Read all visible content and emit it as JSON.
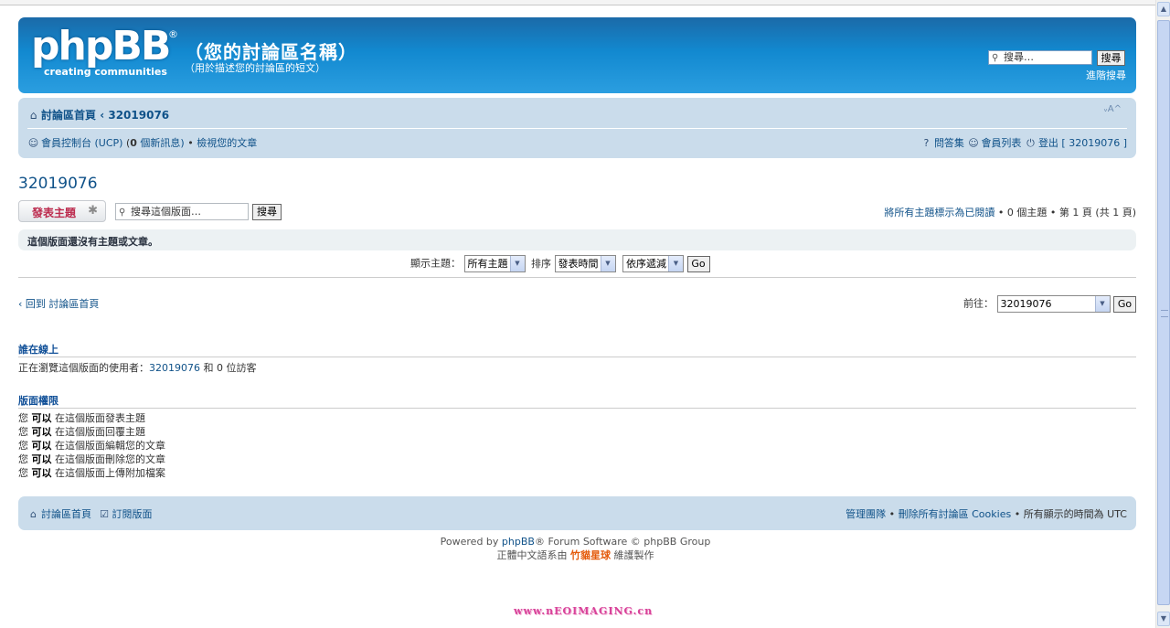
{
  "header": {
    "logo_word": "phpBB",
    "logo_reg": "®",
    "logo_tagline": "creating   communities",
    "site_title": "（您的討論區名稱）",
    "site_desc": "（用於描述您的討論區的短文）",
    "search_placeholder": "搜尋…",
    "search_button": "搜尋",
    "advanced_search": "進階搜尋"
  },
  "navbar": {
    "home": "討論區首頁",
    "crumb_sep": "‹",
    "crumb_current": "32019076",
    "font_size_toggle": "ᵥA^",
    "ucp": "會員控制台 (UCP)",
    "pm_open": "(",
    "pm_count": "0",
    "pm_text": " 個新訊息)",
    "bullet": "•",
    "view_posts": "檢視您的文章",
    "faq": "問答集",
    "memberlist": "會員列表",
    "logout": "登出 [ 32019076 ]"
  },
  "forum": {
    "title": "32019076",
    "post_button": "發表主題",
    "search_placeholder": "搜尋這個版面…",
    "search_button": "搜尋",
    "mark_read": "將所有主題標示為已閱讀",
    "topic_count": "0 個主題",
    "page_info": "第 1 頁 (共 1 頁)",
    "no_topics": "這個版面還沒有主題或文章。"
  },
  "sort": {
    "display_label": "顯示主題：",
    "display_value": "所有主題",
    "sort_label": "排序",
    "sort_value": "發表時間",
    "order_value": "依序遞減",
    "go": "Go"
  },
  "jump": {
    "return_link": "回到 討論區首頁",
    "jump_label": "前往：",
    "jump_value": "32019076",
    "go": "Go"
  },
  "online": {
    "title": "誰在線上",
    "text_prefix": "正在瀏覽這個版面的使用者：",
    "user": "32019076",
    "text_suffix": " 和 0 位訪客"
  },
  "permissions": {
    "title": "版面權限",
    "items": [
      {
        "you": "您",
        "can": "可以",
        "text": "在這個版面發表主題"
      },
      {
        "you": "您",
        "can": "可以",
        "text": "在這個版面回覆主題"
      },
      {
        "you": "您",
        "can": "可以",
        "text": "在這個版面編輯您的文章"
      },
      {
        "you": "您",
        "can": "可以",
        "text": "在這個版面刪除您的文章"
      },
      {
        "you": "您",
        "can": "可以",
        "text": "在這個版面上傳附加檔案"
      }
    ]
  },
  "footer": {
    "home": "討論區首頁",
    "subscribe": "訂閱版面",
    "team": "管理團隊",
    "delete_cookies": "刪除所有討論區 Cookies",
    "timezone": "所有顯示的時間為 UTC"
  },
  "copyright": {
    "powered_prefix": "Powered by ",
    "powered_brand": "phpBB",
    "powered_suffix": "® Forum Software © phpBB Group",
    "translation_prefix": "正體中文語系由 ",
    "translation_brand": "竹貓星球",
    "translation_suffix": " 維護製作"
  },
  "watermark": "www.nEOIMAGING.cn",
  "colors": {
    "header_blue": "#1289d0",
    "nav_bg": "#cadceb",
    "link": "#105289",
    "post_button_text": "#bc2a4d",
    "brand_orange": "#e45a0b"
  }
}
